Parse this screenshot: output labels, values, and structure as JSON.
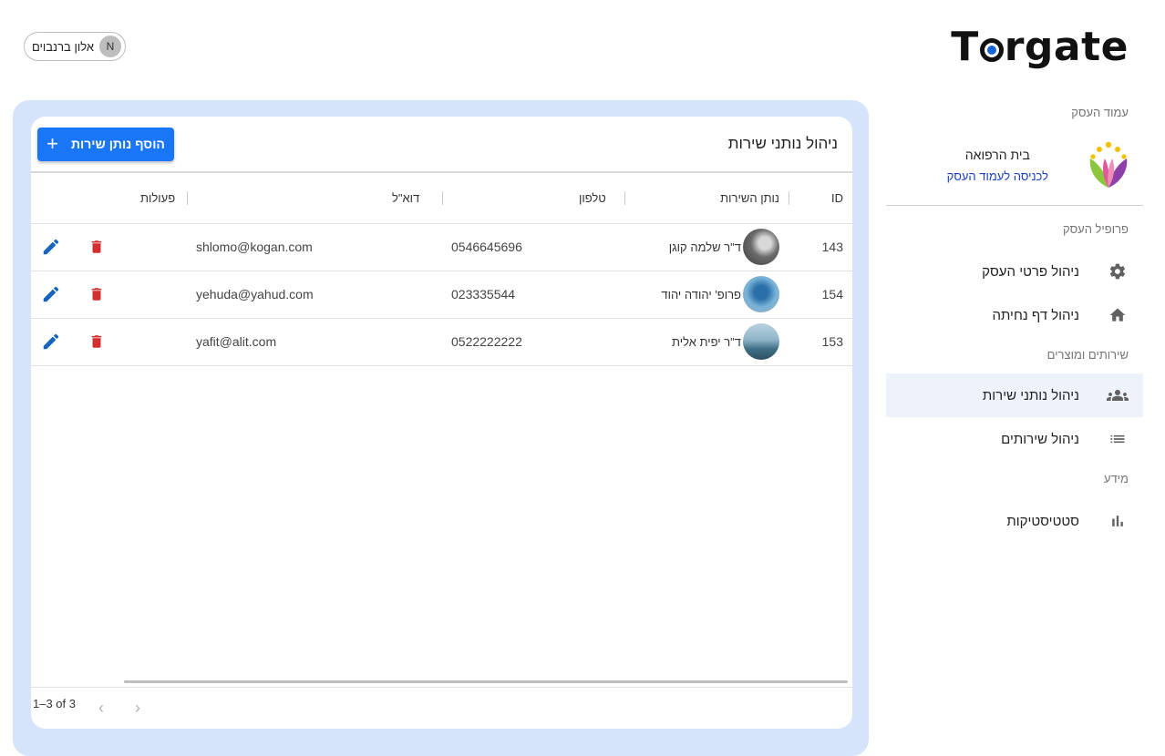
{
  "header": {
    "user_name": "אלון ברנבוים",
    "user_initial": "N",
    "logo_text_pre": "T",
    "logo_text_post": "rgate"
  },
  "sidebar": {
    "section_business_page": "עמוד העסק",
    "business_name": "בית הרפואה",
    "business_link": "לכניסה לעמוד העסק",
    "section_profile": "פרופיל העסק",
    "item_details": "ניהול פרטי העסק",
    "item_landing": "ניהול דף נחיתה",
    "section_services": "שירותים ומוצרים",
    "item_providers": "ניהול נותני שירות",
    "item_services": "ניהול שירותים",
    "section_info": "מידע",
    "item_stats": "סטטיסטיקות"
  },
  "main": {
    "title": "ניהול נותני שירות",
    "add_button": "הוסף נותן שירות",
    "columns": {
      "id": "ID",
      "provider": "נותן השירות",
      "phone": "טלפון",
      "email": "דוא\"ל",
      "actions": "פעולות"
    },
    "rows": [
      {
        "id": "143",
        "name": "ד\"ר שלמה קוגן",
        "phone": "0546645696",
        "email": "shlomo@kogan.com"
      },
      {
        "id": "154",
        "name": "פרופ' יהודה יהוד",
        "phone": "023335544",
        "email": "yehuda@yahud.com"
      },
      {
        "id": "153",
        "name": "ד\"ר יפית אלית",
        "phone": "0522222222",
        "email": "yafit@alit.com"
      }
    ],
    "pagination": "1–3 of 3"
  },
  "colors": {
    "accent": "#1976f7",
    "panel_bg": "#d6e4fb",
    "active_item_bg": "#eef3fb",
    "delete": "#d32f2f",
    "edit": "#1565c0"
  }
}
